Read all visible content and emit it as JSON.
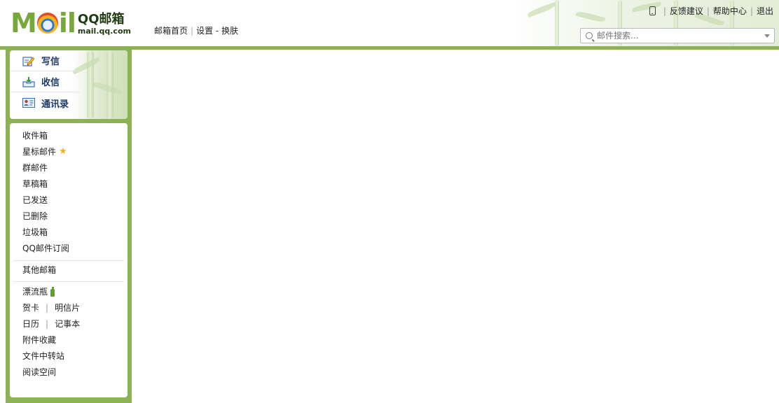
{
  "logo": {
    "moil_m": "M",
    "moil_il": "il",
    "name": "QQ邮箱",
    "url": "mail.qq.com"
  },
  "topnav": {
    "home": "邮箱首页",
    "settings": "设置",
    "dash": "-",
    "skin": "换肤"
  },
  "toplinks": {
    "feedback": "反馈建议",
    "help": "帮助中心",
    "logout": "退出"
  },
  "search": {
    "placeholder": "邮件搜索..."
  },
  "actions": [
    {
      "label": "写信",
      "icon": "compose-icon"
    },
    {
      "label": "收信",
      "icon": "inbox-download-icon"
    },
    {
      "label": "通讯录",
      "icon": "contacts-card-icon"
    }
  ],
  "folders": {
    "inbox": "收件箱",
    "starred": "星标邮件",
    "group": "群邮件",
    "drafts": "草稿箱",
    "sent": "已发送",
    "deleted": "已删除",
    "spam": "垃圾箱",
    "subscriptions": "QQ邮件订阅",
    "other": "其他邮箱",
    "bottle": "漂流瓶",
    "card": "贺卡",
    "postcard": "明信片",
    "calendar": "日历",
    "notes": "记事本",
    "attachments": "附件收藏",
    "filestation": "文件中转站",
    "reading": "阅读空间"
  },
  "colors": {
    "accent_green": "#8db255",
    "logo_green": "#78a83a",
    "star": "#f2b318"
  }
}
